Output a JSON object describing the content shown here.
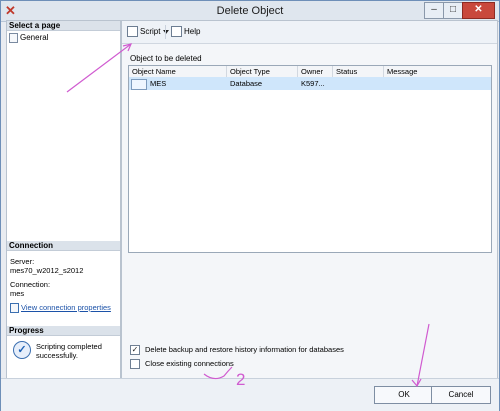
{
  "window": {
    "title": "Delete Object"
  },
  "sidebar": {
    "select_page_header": "Select a page",
    "items": [
      {
        "label": "General"
      }
    ],
    "connection_header": "Connection",
    "server_label": "Server:",
    "server_value": "mes70_w2012_s2012",
    "connection_label": "Connection:",
    "connection_value": "mes",
    "view_properties_link": "View connection properties",
    "progress_header": "Progress",
    "progress_status": "Scripting completed successfully."
  },
  "toolbar": {
    "script_label": "Script",
    "help_label": "Help"
  },
  "main": {
    "section_label": "Object to be deleted",
    "columns": [
      "Object Name",
      "Object Type",
      "Owner",
      "Status",
      "Message"
    ],
    "rows": [
      {
        "name": "MES",
        "type": "Database",
        "owner": "K597...",
        "status": "",
        "message": ""
      }
    ],
    "checkbox_delete_backup": {
      "label": "Delete backup and restore history information for databases",
      "checked": true
    },
    "checkbox_close_connections": {
      "label": "Close existing connections",
      "checked": false
    },
    "annotation_number": "2"
  },
  "footer": {
    "ok_label": "OK",
    "cancel_label": "Cancel"
  },
  "colors": {
    "annotation": "#d05bd0",
    "selection": "#cfe6fb",
    "link": "#1c52a8"
  }
}
